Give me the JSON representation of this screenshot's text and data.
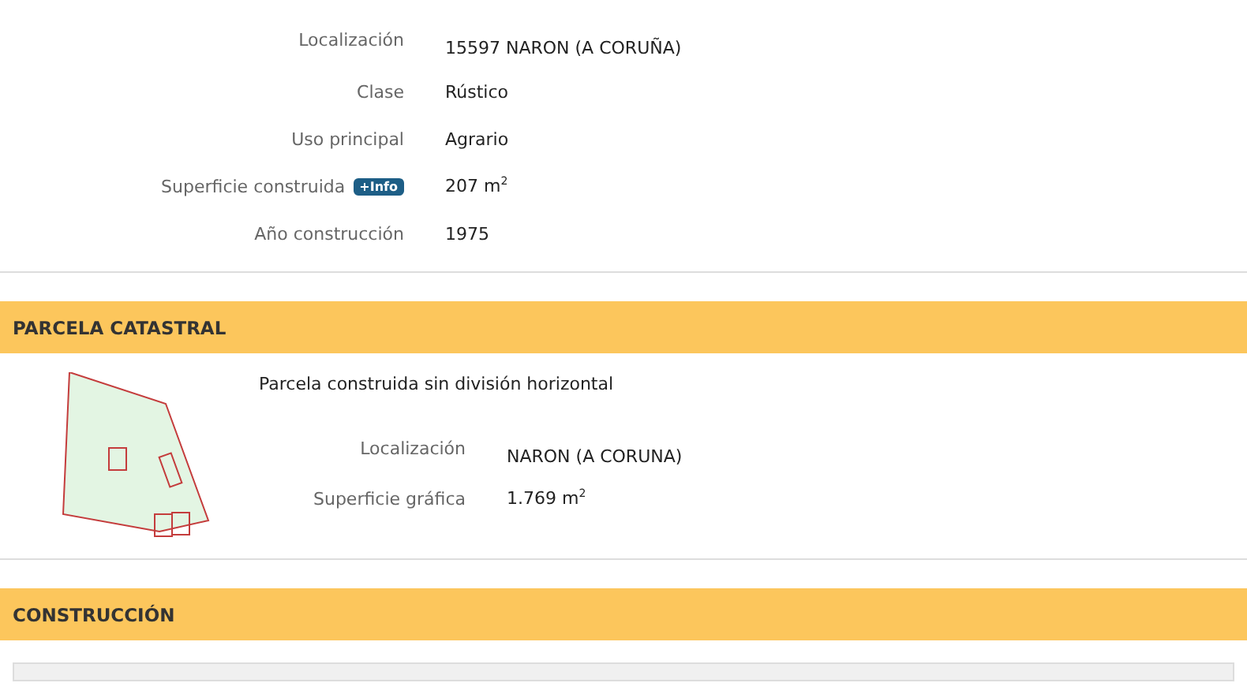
{
  "inmueble": {
    "fields": [
      {
        "label": "Localización",
        "value": "15597 NARON (A CORUÑA)"
      },
      {
        "label": "Clase",
        "value": "Rústico"
      },
      {
        "label": "Uso principal",
        "value": "Agrario"
      },
      {
        "label": "Superficie construida",
        "badge": "+Info",
        "value": "207 m$^{2}$"
      },
      {
        "label": "Año construcción",
        "value": "1975"
      }
    ]
  },
  "parcela": {
    "title": "PARCELA CATASTRAL",
    "description": "Parcela construida sin división horizontal",
    "fields": [
      {
        "label": "Localización",
        "value": "NARON (A CORUNA)"
      },
      {
        "label": "Superficie gráfica",
        "value": "1.769 m$^{2}$"
      }
    ]
  },
  "construccion": {
    "title": "CONSTRUCCIÓN"
  }
}
